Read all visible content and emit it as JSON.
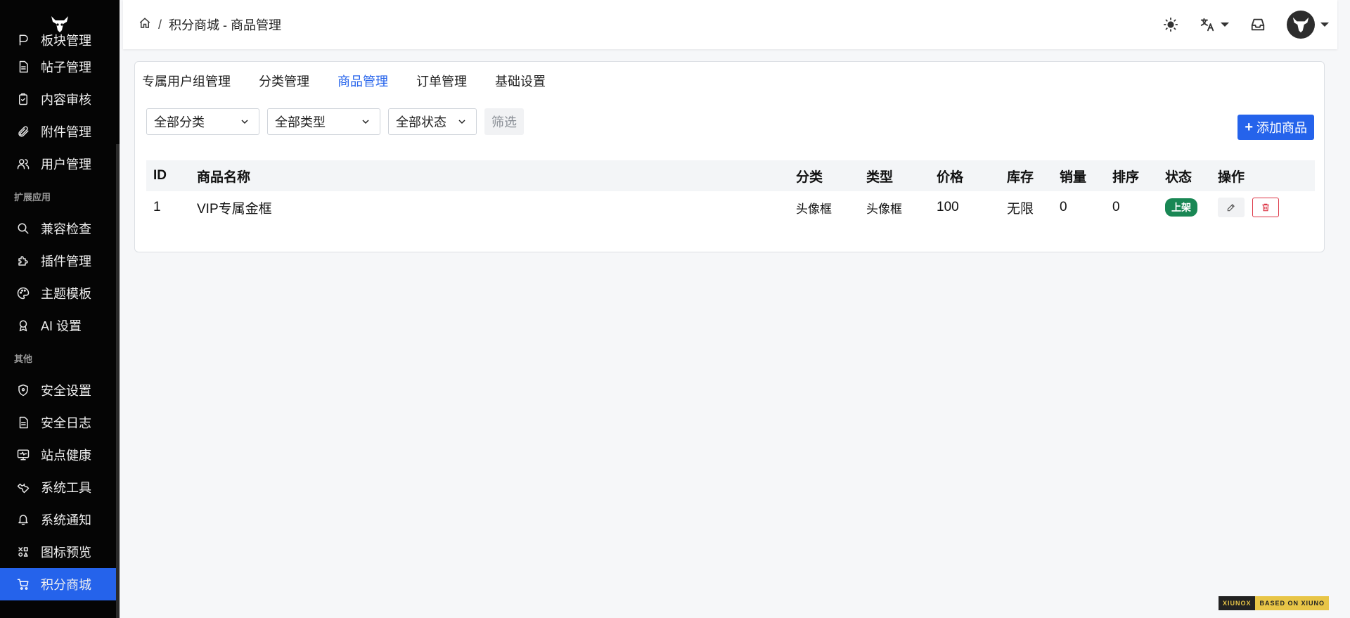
{
  "sidebar": {
    "items": [
      {
        "label": "板块管理",
        "icon": "board-icon"
      },
      {
        "label": "帖子管理",
        "icon": "document-icon"
      },
      {
        "label": "内容审核",
        "icon": "clipboard-check-icon"
      },
      {
        "label": "附件管理",
        "icon": "paperclip-icon"
      },
      {
        "label": "用户管理",
        "icon": "users-icon"
      }
    ],
    "section_extend": "扩展应用",
    "extend_items": [
      {
        "label": "兼容检查",
        "icon": "search-icon"
      },
      {
        "label": "插件管理",
        "icon": "puzzle-icon"
      },
      {
        "label": "主题模板",
        "icon": "palette-icon"
      },
      {
        "label": "AI 设置",
        "icon": "ai-badge-icon"
      }
    ],
    "section_other": "其他",
    "other_items": [
      {
        "label": "安全设置",
        "icon": "shield-icon"
      },
      {
        "label": "安全日志",
        "icon": "log-icon"
      },
      {
        "label": "站点健康",
        "icon": "monitor-icon"
      },
      {
        "label": "系统工具",
        "icon": "wrench-icon"
      },
      {
        "label": "系统通知",
        "icon": "bell-icon"
      },
      {
        "label": "图标预览",
        "icon": "icons-grid-icon"
      },
      {
        "label": "积分商城",
        "icon": "cart-icon"
      }
    ]
  },
  "header": {
    "breadcrumb_sep": "/",
    "breadcrumb_title": "积分商城 - 商品管理"
  },
  "tabs": [
    "专属用户组管理",
    "分类管理",
    "商品管理",
    "订单管理",
    "基础设置"
  ],
  "filters": {
    "category": "全部分类",
    "type": "全部类型",
    "status": "全部状态",
    "filter_button": "筛选"
  },
  "add_button": "添加商品",
  "table": {
    "headers": [
      "ID",
      "商品名称",
      "分类",
      "类型",
      "价格",
      "库存",
      "销量",
      "排序",
      "状态",
      "操作"
    ],
    "rows": [
      {
        "id": "1",
        "name": "VIP专属金框",
        "category": "头像框",
        "type": "头像框",
        "price": "100",
        "stock": "无限",
        "sales": "0",
        "sort": "0",
        "status": "上架"
      }
    ]
  },
  "footer": {
    "left": "XIUNOX",
    "right": "BASED ON XIUNO"
  },
  "colors": {
    "accent": "#2563eb",
    "sidebar_bg": "#050505",
    "status_on": "#198754",
    "danger": "#dc3545"
  }
}
